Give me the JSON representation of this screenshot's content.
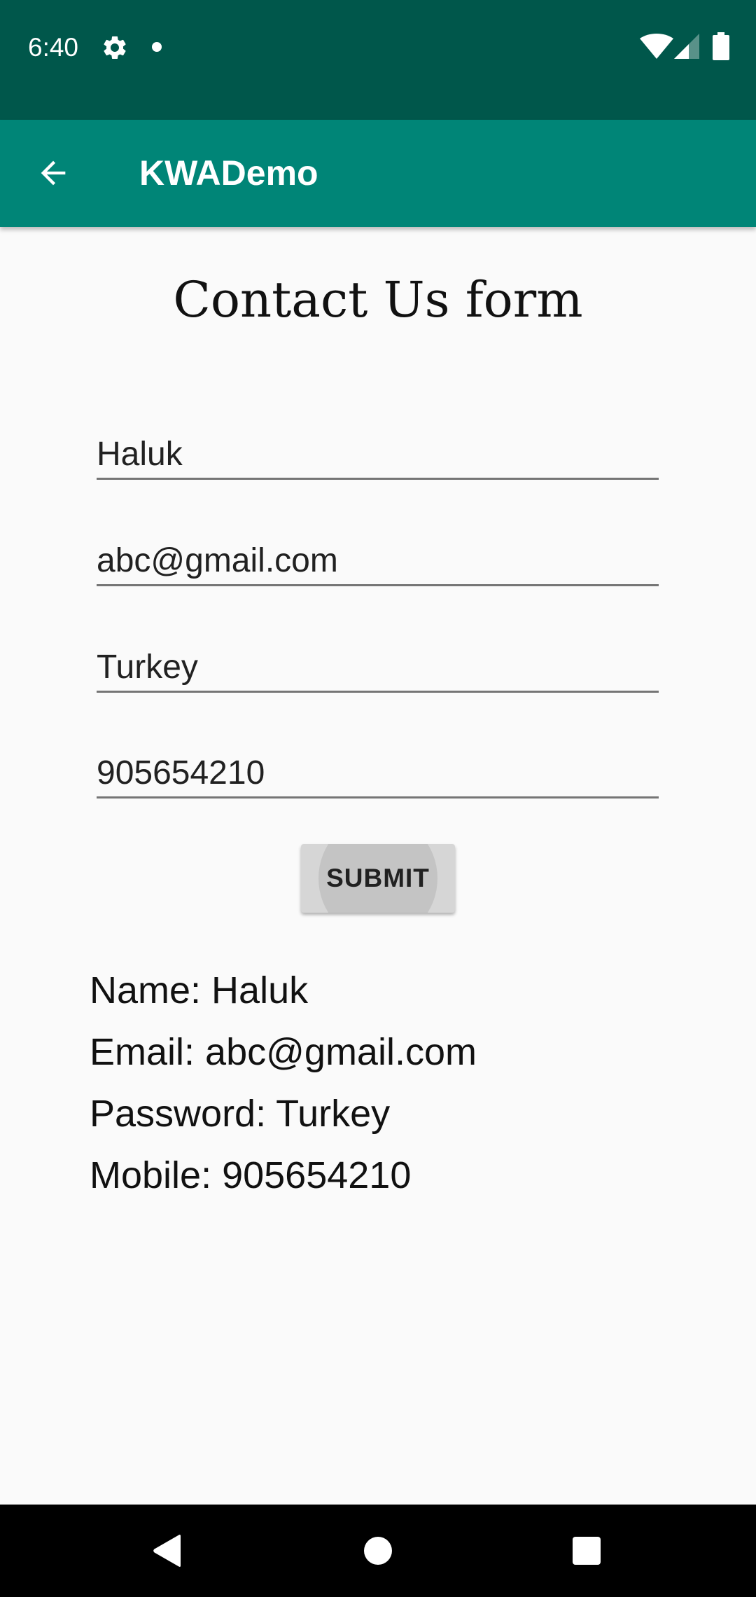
{
  "status_bar": {
    "time": "6:40",
    "background": "#00574b",
    "icons": [
      "settings-gear-icon",
      "notification-dot-icon",
      "wifi-icon",
      "cell-signal-icon",
      "battery-icon"
    ]
  },
  "app_bar": {
    "title": "KWADemo",
    "background": "#008577",
    "back_icon": "arrow-back-icon"
  },
  "form": {
    "title": "Contact Us form",
    "fields": [
      {
        "name": "name",
        "value": "Haluk"
      },
      {
        "name": "email",
        "value": "abc@gmail.com"
      },
      {
        "name": "password",
        "value": "Turkey"
      },
      {
        "name": "mobile",
        "value": "905654210"
      }
    ],
    "submit_label": "SUBMIT"
  },
  "results": {
    "name_line": "Name: Haluk",
    "email_line": "Email: abc@gmail.com",
    "password_line": "Password: Turkey",
    "mobile_line": "Mobile: 905654210"
  },
  "nav_bar": {
    "icons": [
      "nav-back-icon",
      "nav-home-icon",
      "nav-recents-icon"
    ]
  }
}
